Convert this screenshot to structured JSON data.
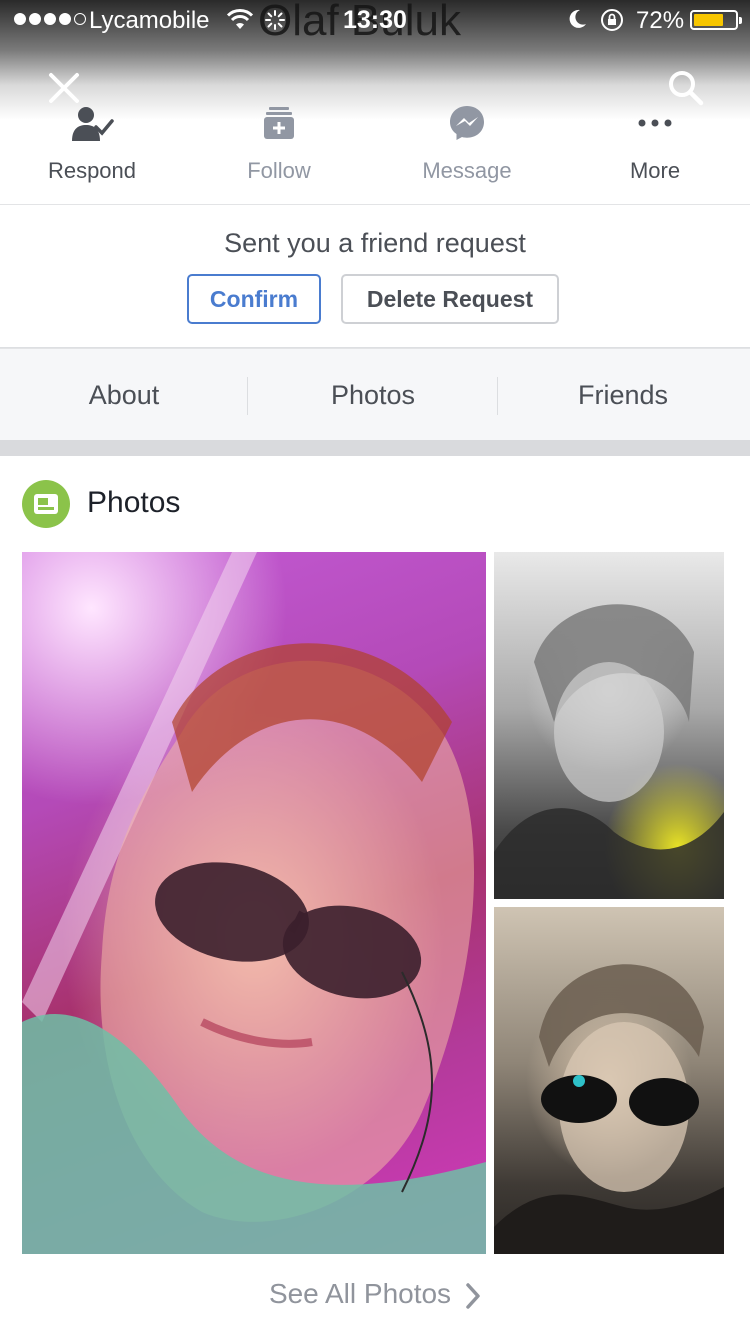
{
  "status_bar": {
    "carrier": "Lycamobile",
    "time": "13:30",
    "battery_percent": "72%",
    "battery_level": 0.72
  },
  "header": {
    "profile_name": "Olaf Buluk"
  },
  "actions": [
    {
      "label": "Respond",
      "icon": "respond-friend-icon"
    },
    {
      "label": "Follow",
      "icon": "follow-icon"
    },
    {
      "label": "Message",
      "icon": "messenger-icon"
    },
    {
      "label": "More",
      "icon": "more-dots-icon"
    }
  ],
  "friend_request": {
    "text": "Sent you a friend request",
    "confirm_label": "Confirm",
    "delete_label": "Delete Request"
  },
  "tabs": [
    "About",
    "Photos",
    "Friends"
  ],
  "photos": {
    "title": "Photos",
    "see_all_label": "See All Photos"
  },
  "colors": {
    "accent": "#4a7ccf",
    "photos_badge": "#8bc34a",
    "battery": "#f7c600"
  }
}
